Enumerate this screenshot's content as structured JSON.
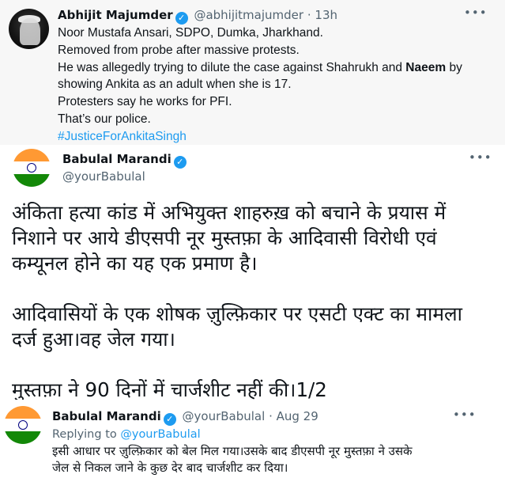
{
  "tweet_top": {
    "author_name": "Abhijit Majumder",
    "handle": "@abhijitmajumder",
    "time": "13h",
    "lines": [
      "Noor Mustafa Ansari, SDPO, Dumka, Jharkhand.",
      "Removed from probe after massive protests.",
      "Protesters say he works for PFI.",
      "That’s our police."
    ],
    "line3_before": "He was allegedly trying to dilute the case against Shahrukh and ",
    "line3_bold": "Naeem",
    "line3_after": " by",
    "line4": "showing Ankita as an adult when she is 17.",
    "hashtag": "#JusticeForAnkitaSingh"
  },
  "tweet_main": {
    "author_name": "Babulal Marandi",
    "handle": "@yourBabulal",
    "body_lines": [
      "अंकिता हत्या कांड में अभियुक्त शाहरुख़ को बचाने के प्रयास में",
      "निशाने पर आये डीएसपी नूर मुस्तफ़ा के आदिवासी विरोधी एवं",
      "कम्यूनल होने का यह एक प्रमाण है।",
      "आदिवासियों के एक शोषक ज़ुल्फ़िकार पर एसटी एक्ट का मामला",
      "दर्ज हुआ।वह जेल गया।",
      "मुस्तफ़ा ने 90 दिनों में चार्जशीट नहीं की।1/2"
    ]
  },
  "tweet_reply": {
    "author_name": "Babulal Marandi",
    "handle": "@yourBabulal",
    "date": "Aug 29",
    "replying_label": "Replying to",
    "replying_to": "@yourBabulal",
    "body_lines": [
      "इसी आधार पर ज़ुल्फ़िकार को बेल मिल गया।उसके बाद डीएसपी नूर मुस्तफ़ा ने उसके",
      "जेल से निकल जाने के कुछ देर बाद चार्जशीट कर दिया।"
    ]
  },
  "ui": {
    "more_glyph": "•••",
    "separator": "·",
    "verified_glyph": "✓"
  },
  "colors": {
    "link": "#1d9bf0",
    "muted": "#536471",
    "verified": "#1d9bf0"
  },
  "icons": [
    "verified-badge-icon",
    "more-options-icon"
  ]
}
